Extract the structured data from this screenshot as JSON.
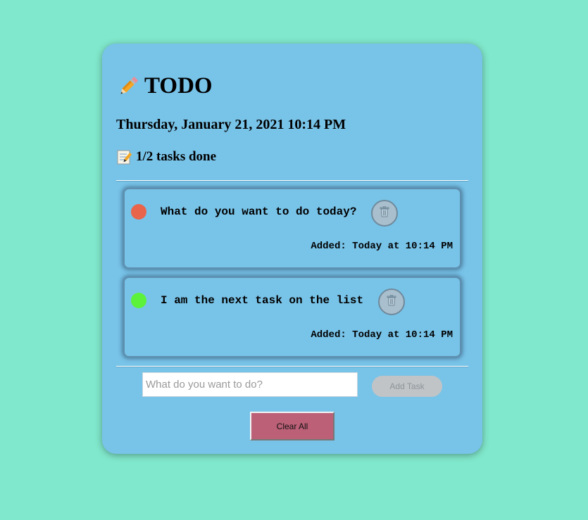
{
  "header": {
    "title": "TODO",
    "title_icon": "pencil-icon",
    "date": "Thursday, January 21, 2021 10:14 PM",
    "progress": "1/2 tasks done",
    "progress_icon": "memo-icon"
  },
  "tasks": [
    {
      "text": "What do you want to do today?",
      "added": "Added: Today at 10:14 PM",
      "done": false,
      "status_color": "#e8644b",
      "delete_icon": "trash-icon"
    },
    {
      "text": "I am the next task on the list",
      "added": "Added: Today at 10:14 PM",
      "done": true,
      "status_color": "#5cf23c",
      "delete_icon": "trash-icon"
    }
  ],
  "form": {
    "placeholder": "What do you want to do?",
    "value": "",
    "add_label": "Add Task",
    "clear_label": "Clear All"
  },
  "colors": {
    "background": "#80e8cc",
    "card": "#78c3e8",
    "clear_button": "#bb6077",
    "add_button": "#c0c4c7"
  }
}
